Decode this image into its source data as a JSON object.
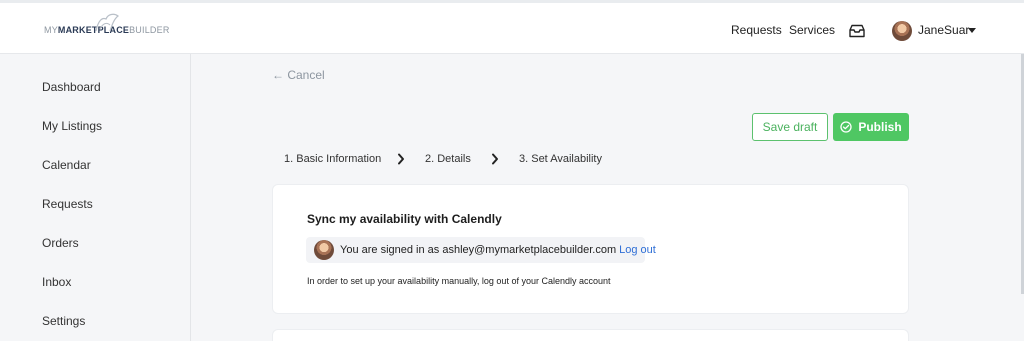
{
  "header": {
    "logo": {
      "my": "MY",
      "marketplace": "MARKETPLACE",
      "builder": "BUILDER"
    },
    "nav": [
      {
        "label": "Requests"
      },
      {
        "label": "Services"
      }
    ],
    "inbox_icon": "tray-icon",
    "user": {
      "name": "JaneSuar"
    }
  },
  "sidebar": {
    "items": [
      {
        "label": "Dashboard"
      },
      {
        "label": "My Listings"
      },
      {
        "label": "Calendar"
      },
      {
        "label": "Requests"
      },
      {
        "label": "Orders"
      },
      {
        "label": "Inbox"
      },
      {
        "label": "Settings"
      }
    ]
  },
  "main": {
    "cancel_label": "← Cancel",
    "save_draft_label": "Save draft",
    "publish_label": "Publish",
    "steps": [
      {
        "label": "1. Basic Information"
      },
      {
        "label": "2. Details"
      },
      {
        "label": "3. Set Availability"
      }
    ],
    "card": {
      "title": "Sync my availability with Calendly",
      "signed_in_prefix": "You are signed in as ashley@mymarketplacebuilder.com",
      "logout_label": "Log out",
      "note": "In order to set up your availability manually, log out of your Calendly account"
    }
  },
  "colors": {
    "accent_green": "#4fc763",
    "link_blue": "#2f6fd6",
    "background": "#f5f6f8"
  }
}
